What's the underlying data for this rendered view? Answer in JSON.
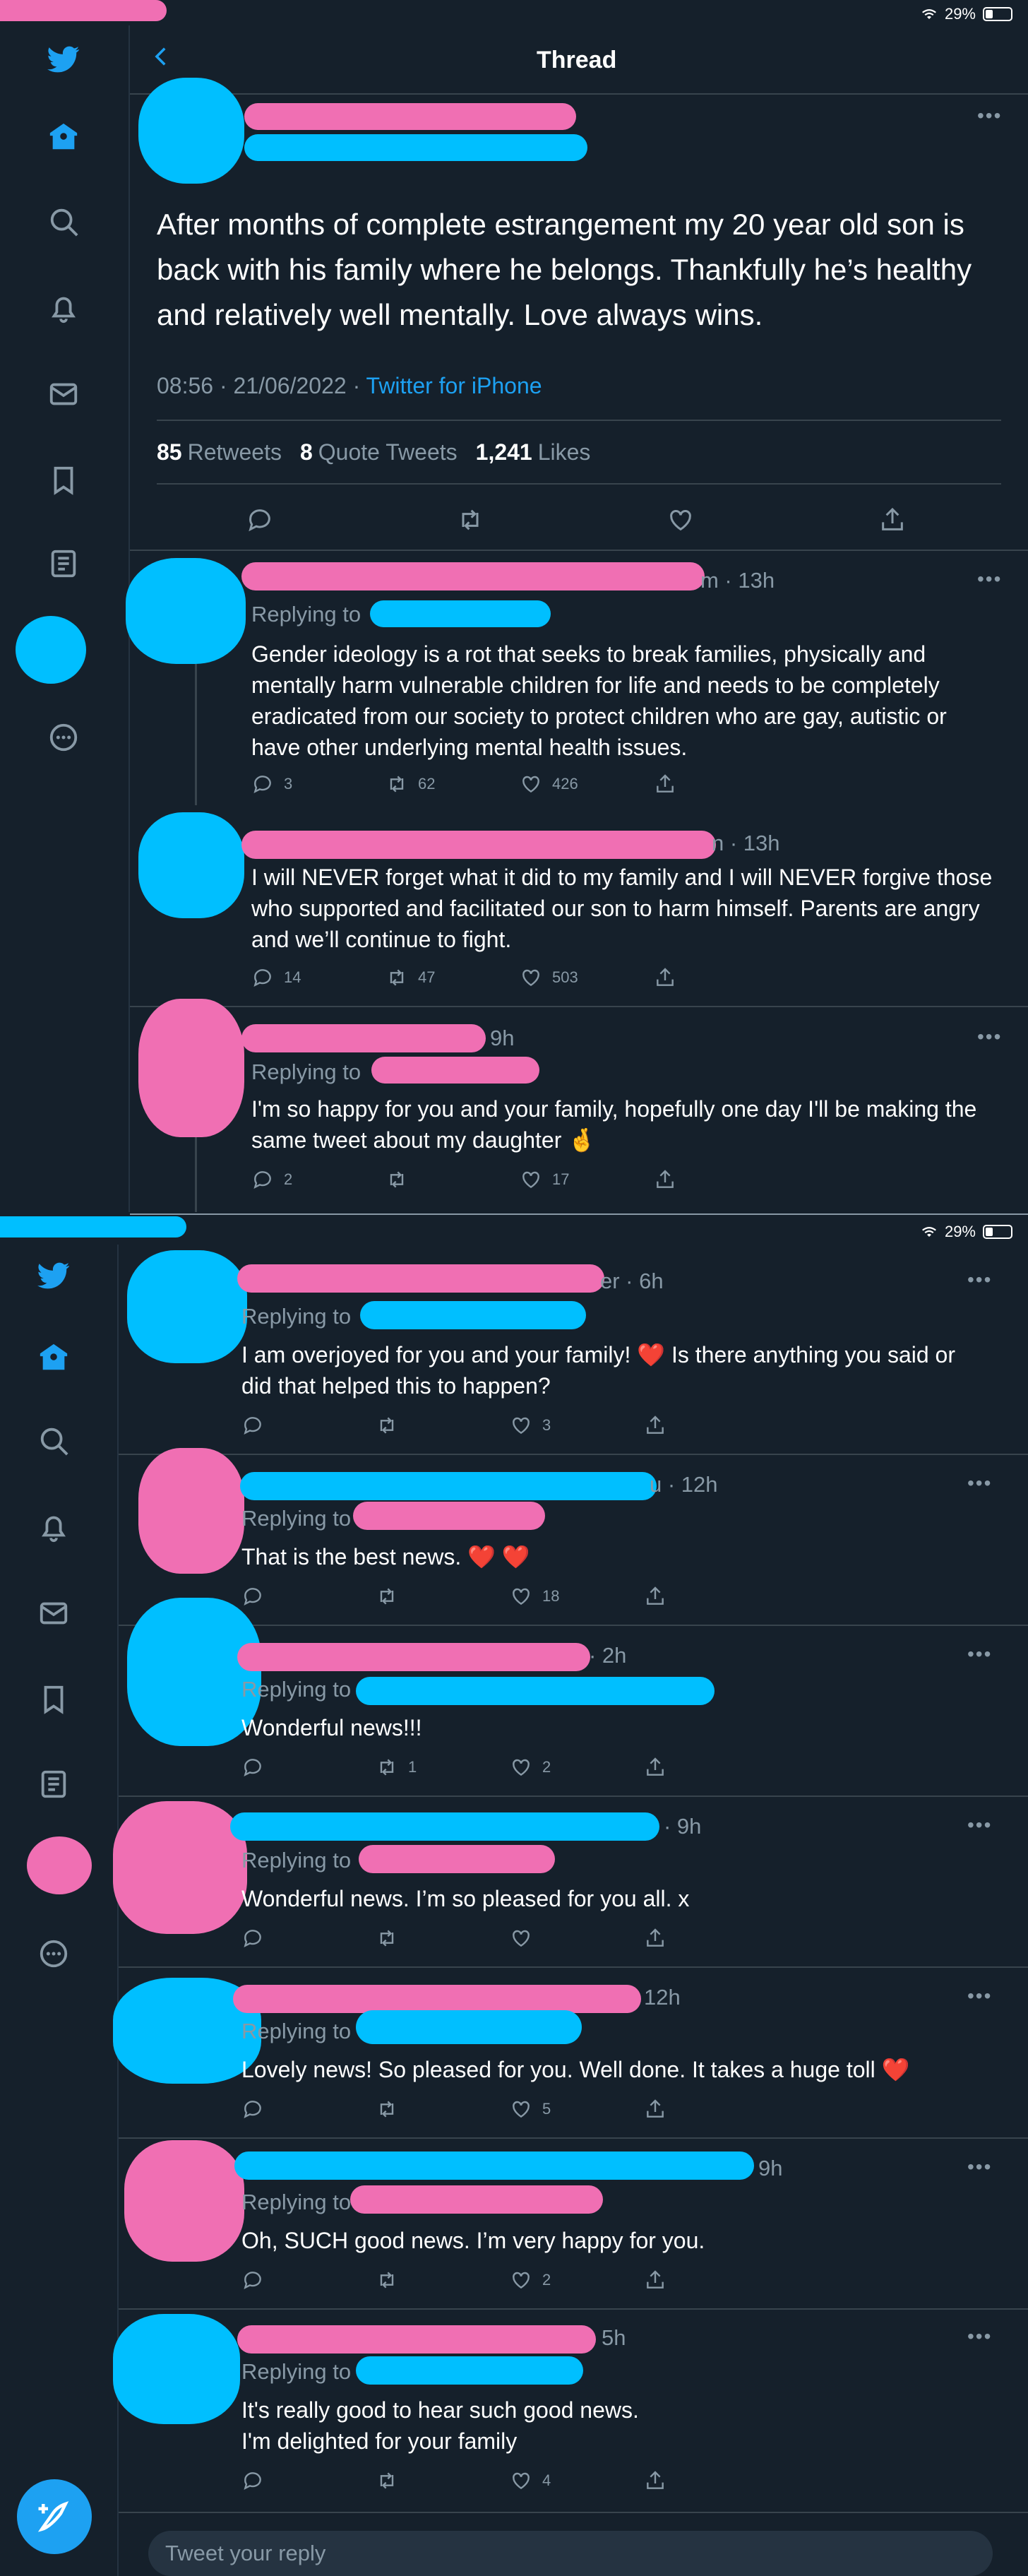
{
  "status": {
    "battery": "29%"
  },
  "header": {
    "title": "Thread"
  },
  "main_tweet": {
    "text": "After months of complete estrangement my 20 year old son is back with his family where he belongs. Thankfully he’s healthy and relatively well mentally.  Love always wins.",
    "date": "08:56 · 21/06/2022 · ",
    "source": "Twitter for iPhone",
    "retweets": "85",
    "retweets_label": "Retweets",
    "quotes": "8",
    "quotes_label": "Quote Tweets",
    "likes": "1,241",
    "likes_label": "Likes"
  },
  "replies_top": [
    {
      "time": "m · 13h",
      "replying_label": "Replying to",
      "text": "Gender ideology is a rot that seeks to break families, physically and mentally harm vulnerable children for life and needs to be completely eradicated from our society to protect children who are gay, autistic or have other underlying mental health issues.",
      "replies": "3",
      "retweets": "62",
      "likes": "426"
    },
    {
      "time": "n · 13h",
      "text": "I will NEVER forget what it did to my family and I will NEVER forgive those who supported and facilitated our son to harm himself. Parents are angry and we’ll continue to fight.",
      "replies": "14",
      "retweets": "47",
      "likes": "503"
    },
    {
      "time": "9h",
      "replying_label": "Replying to",
      "text": "I'm so happy for you and your family, hopefully one day I'll be making the same tweet about my daughter 🤞",
      "replies": "2",
      "retweets": "",
      "likes": "17"
    }
  ],
  "replies_bottom": [
    {
      "time": "er · 6h",
      "replying_label": "Replying to",
      "text": "I am overjoyed for you and your family! ❤️ Is there anything you said or did that helped this to happen?",
      "replies": "",
      "retweets": "",
      "likes": "3"
    },
    {
      "time": "u · 12h",
      "replying_label": "Replying to",
      "text": "That is the best news. ❤️ ❤️",
      "replies": "",
      "retweets": "",
      "likes": "18"
    },
    {
      "time": "· 2h",
      "replying_label": "Replying to",
      "text": "Wonderful news!!!",
      "replies": "",
      "retweets": "1",
      "likes": "2"
    },
    {
      "time": "· 9h",
      "replying_label": "Replying to",
      "text": "Wonderful news. I’m so pleased for you all. x",
      "replies": "",
      "retweets": "",
      "likes": ""
    },
    {
      "time": "12h",
      "replying_label": "Replying to",
      "text": "Lovely news! So pleased for you. Well done. It takes a huge toll ❤️",
      "replies": "",
      "retweets": "",
      "likes": "5"
    },
    {
      "time": "9h",
      "replying_label": "Replying to",
      "text": "Oh, SUCH good news. I’m very happy for you.",
      "replies": "",
      "retweets": "",
      "likes": "2"
    },
    {
      "time": "5h",
      "replying_label": "Replying to",
      "text": "It's really good to hear such good news.\nI'm delighted for your family",
      "replies": "",
      "retweets": "",
      "likes": "4"
    }
  ],
  "reply_box": {
    "placeholder": "Tweet your reply"
  },
  "icons": [
    "twitter-bird-icon",
    "home-icon",
    "search-icon",
    "bell-icon",
    "mail-icon",
    "bookmark-icon",
    "list-icon",
    "more-circle-icon",
    "reply-icon",
    "retweet-icon",
    "like-icon",
    "share-icon",
    "back-icon",
    "compose-icon"
  ],
  "colors": {
    "background": "#15202b",
    "accent": "#1da1f2",
    "muted": "#8899a6",
    "border": "#38444d"
  }
}
